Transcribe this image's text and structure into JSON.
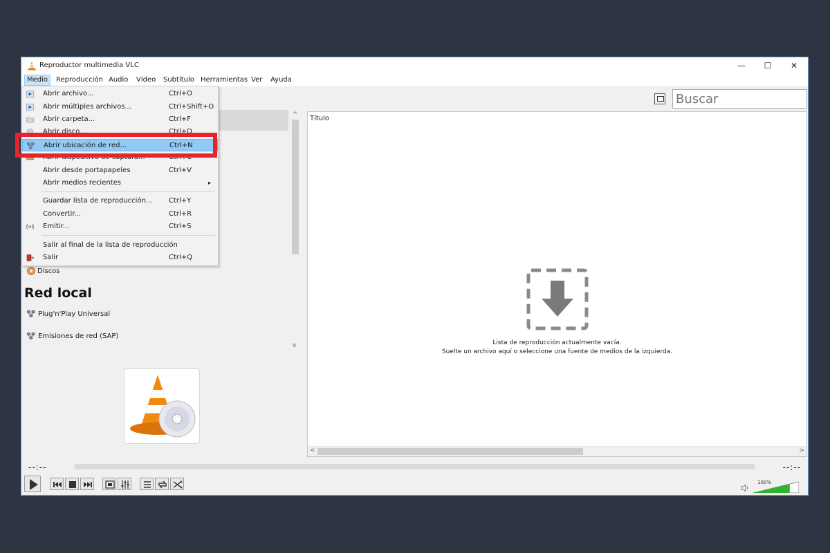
{
  "window": {
    "title": "Reproductor multimedia VLC",
    "controls": {
      "minimize": "—",
      "maximize": "☐",
      "close": "✕"
    }
  },
  "menubar": {
    "items": [
      "Medio",
      "Reproducción",
      "Audio",
      "Vídeo",
      "Subtítulo",
      "Herramientas",
      "Ver",
      "Ayuda"
    ]
  },
  "media_menu": {
    "items": [
      {
        "label": "Abrir archivo...",
        "shortcut": "Ctrl+O",
        "icon": "play-file-icon"
      },
      {
        "label": "Abrir múltiples archivos...",
        "shortcut": "Ctrl+Shift+O",
        "icon": "play-file-icon"
      },
      {
        "label": "Abrir carpeta...",
        "shortcut": "Ctrl+F",
        "icon": "folder-icon"
      },
      {
        "label": "Abrir disco...",
        "shortcut": "Ctrl+D",
        "icon": "disc-icon"
      },
      {
        "label": "Abrir ubicación de red...",
        "shortcut": "Ctrl+N",
        "icon": "network-icon"
      },
      {
        "label": "Abrir dispositivo de captura...",
        "shortcut": "Ctrl+C",
        "icon": "capture-icon"
      },
      {
        "label": "Abrir desde portapapeles",
        "shortcut": "Ctrl+V"
      },
      {
        "label": "Abrir medios recientes",
        "submenu": "▸"
      },
      {
        "label": "Guardar lista de reproducción...",
        "shortcut": "Ctrl+Y"
      },
      {
        "label": "Convertir...",
        "shortcut": "Ctrl+R"
      },
      {
        "label": "Emitir...",
        "shortcut": "Ctrl+S",
        "icon": "stream-icon"
      },
      {
        "label": "Salir al final de la lista de reproducción"
      },
      {
        "label": "Salir",
        "shortcut": "Ctrl+Q",
        "icon": "exit-icon"
      }
    ]
  },
  "search": {
    "placeholder": "Buscar"
  },
  "sidebar": {
    "discs_label": "Discos",
    "local_network_title": "Red local",
    "network_items": [
      "Plug'n'Play Universal",
      "Emisiones de red (SAP)"
    ]
  },
  "playlist": {
    "column_title": "Título",
    "empty_line1": "Lista de reproducción actualmente vacía.",
    "empty_line2": "Suelte un archivo aquí o seleccione una fuente de medios de la izquierda."
  },
  "player": {
    "time_elapsed": "--:--",
    "time_total": "--:--",
    "volume_label": "100%",
    "volume_level": 1.0
  },
  "colors": {
    "background": "#2d3442",
    "highlight_red": "#e3262d",
    "menu_selection": "#91c9f7",
    "volume_green": "#2db52d"
  }
}
